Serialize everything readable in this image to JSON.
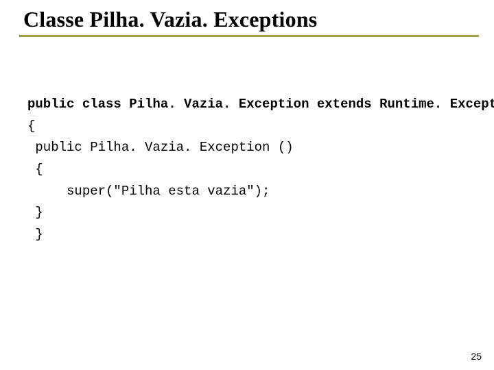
{
  "title": "Classe Pilha. Vazia. Exceptions",
  "code": {
    "declaration": "public class Pilha. Vazia. Exception extends Runtime. Exception",
    "lines": [
      "{",
      " public Pilha. Vazia. Exception ()",
      " {",
      "     super(\"Pilha esta vazia\");",
      " }",
      " }"
    ]
  },
  "page_number": "25"
}
